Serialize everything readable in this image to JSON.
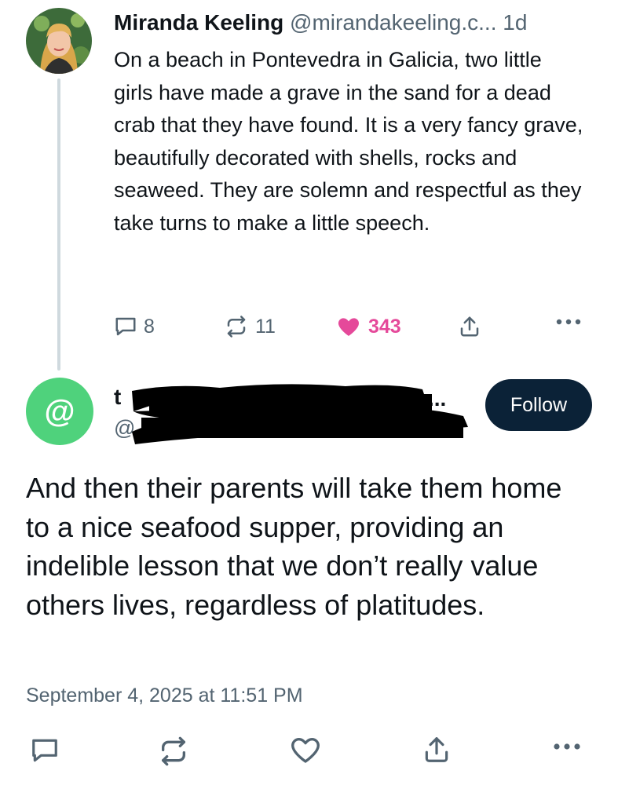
{
  "parent_post": {
    "author_name": "Miranda Keeling",
    "author_handle": "@mirandakeeling.c...",
    "separator": " ",
    "time_ago": "1d",
    "text": "On a beach in Pontevedra in Galicia, two little girls have made a grave in the sand for a dead crab that they have found. It is a very fancy grave, beautifully decorated with shells, rocks and seaweed. They are solemn and respectful as they take turns to make a little speech.",
    "counts": {
      "replies": "8",
      "reposts": "11",
      "likes": "343"
    },
    "liked": true
  },
  "reply_post": {
    "author_name_visible": "t",
    "author_handle_visible": "@",
    "name_truncation": "...",
    "avatar_glyph": "@",
    "follow_label": "Follow",
    "text": "And then their parents will take them home to a nice seafood supper, providing an indelible lesson that we don’t really value others lives, regardless of platitudes.",
    "date": "September 4, 2025 at 11:51 PM"
  },
  "colors": {
    "like_pink": "#e5499a",
    "muted_gray": "#536471",
    "follow_bg": "#0b2237",
    "reply_avatar_green": "#4fd27c",
    "thread_line": "#cfd9de"
  },
  "icons": [
    "reply-icon",
    "repost-icon",
    "heart-icon",
    "share-icon",
    "more-icon"
  ]
}
